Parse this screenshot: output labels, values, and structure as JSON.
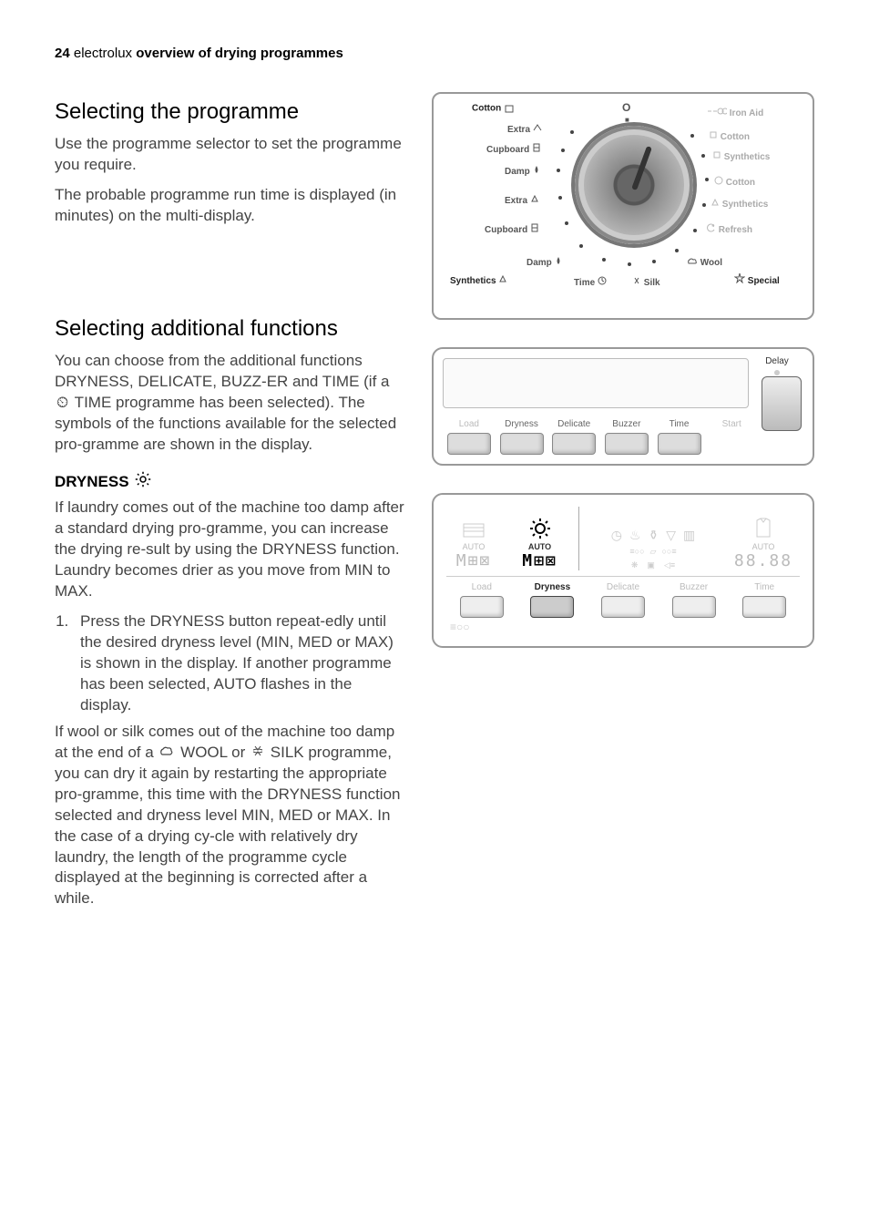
{
  "header": {
    "page_number": "24",
    "brand": "electrolux",
    "section_title": "overview of drying programmes"
  },
  "s1": {
    "heading": "Selecting the programme",
    "p1": "Use the programme selector to set the programme you require.",
    "p2": "The probable programme run time is displayed (in minutes) on the multi-display."
  },
  "s2": {
    "heading": "Selecting additional functions",
    "p1": "You can choose from the additional functions DRYNESS, DELICATE, BUZZ-ER and TIME (if a ",
    "p1_icon": "⏲",
    "p1_b": " TIME programme has been selected). The symbols of the functions available for the selected pro-gramme are shown in the display."
  },
  "dryness": {
    "heading": "DRYNESS",
    "p1": "If laundry comes out of the machine too damp after a standard drying pro-gramme, you can increase the drying re-sult by using the DRYNESS function. Laundry becomes drier as you move from MIN to MAX.",
    "step1": "Press the DRYNESS button repeat-edly until the desired dryness level (MIN, MED or MAX) is shown in the display. If another programme has been selected, AUTO flashes in the display.",
    "p2a": "If wool or silk comes out of the machine too damp at the end of a ",
    "wool_icon": "🐑",
    "p2b": " WOOL or ",
    "silk_icon": "🎀",
    "p2c": " SILK programme, you can dry it again by restarting the appropriate pro-gramme, this time with the DRYNESS function selected and dryness level MIN, MED or MAX. In the case of a drying cy-cle with relatively dry laundry, the length of the programme cycle displayed at the beginning is corrected after a while."
  },
  "dial": {
    "off": "O",
    "off_dot": "■",
    "left": {
      "group": "Cotton",
      "extra": "Extra",
      "cupboard": "Cupboard",
      "damp": "Damp",
      "extra2": "Extra",
      "cupboard2": "Cupboard",
      "damp2": "Damp",
      "group2": "Synthetics",
      "time": "Time"
    },
    "right": {
      "ironaid": "Iron Aid",
      "cotton": "Cotton",
      "synth": "Synthetics",
      "cotton2": "Cotton",
      "synth2": "Synthetics",
      "refresh": "Refresh",
      "wool": "Wool",
      "special": "Special",
      "silk": "Silk"
    }
  },
  "panel": {
    "delay": "Delay",
    "start": "Start",
    "btns": [
      "Load",
      "Dryness",
      "Delicate",
      "Buzzer",
      "Time"
    ]
  },
  "disp": {
    "auto": "AUTO",
    "seg": "M⊞⊠",
    "digits": "88.88",
    "row2": [
      "Load",
      "Dryness",
      "Delicate",
      "Buzzer",
      "Time"
    ]
  }
}
